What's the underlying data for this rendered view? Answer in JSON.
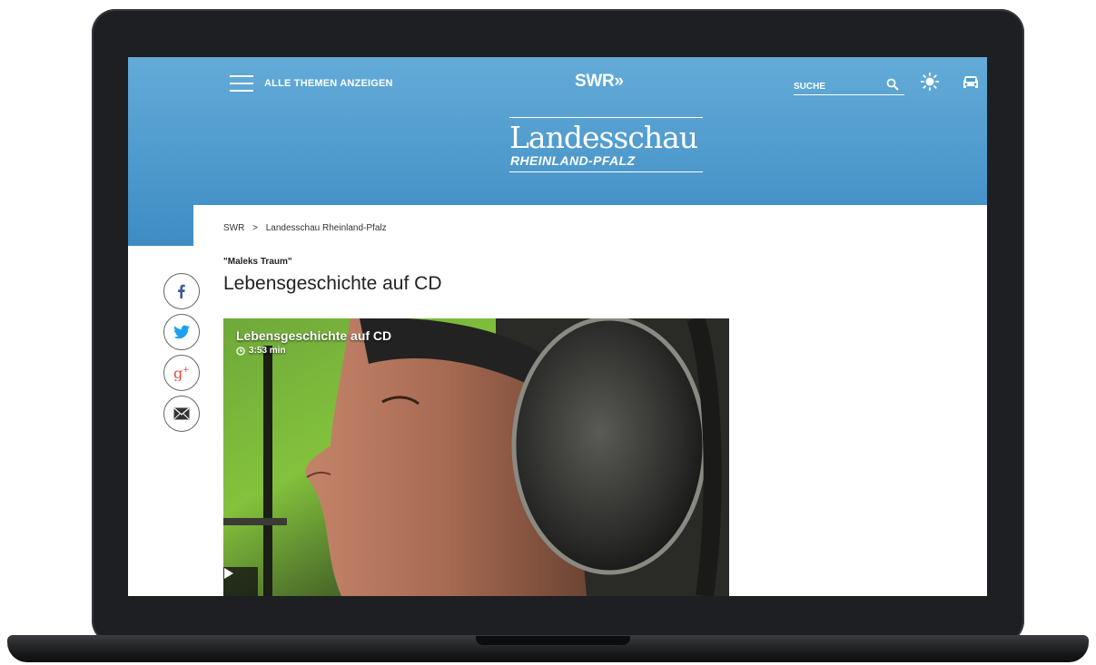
{
  "header": {
    "menu_label": "ALLE THEMEN ANZEIGEN",
    "logo_text": "SWR»",
    "search_placeholder": "SUCHE",
    "background_color": "#4c9bd0"
  },
  "brand": {
    "title": "Landesschau",
    "subtitle": "RHEINLAND-PFALZ"
  },
  "breadcrumb": {
    "items": [
      "SWR",
      "Landesschau Rheinland-Pfalz"
    ],
    "separator": ">"
  },
  "article": {
    "kicker": "\"Maleks Traum\"",
    "headline": "Lebensgeschichte auf CD"
  },
  "video": {
    "title": "Lebensgeschichte auf CD",
    "duration": "3:53 min"
  },
  "share": {
    "icons": [
      "facebook-icon",
      "twitter-icon",
      "google-plus-icon",
      "mail-icon"
    ],
    "colors": {
      "facebook": "#3b5998",
      "twitter": "#1da1f2",
      "google_plus": "#dd4b39",
      "mail": "#333333"
    }
  }
}
